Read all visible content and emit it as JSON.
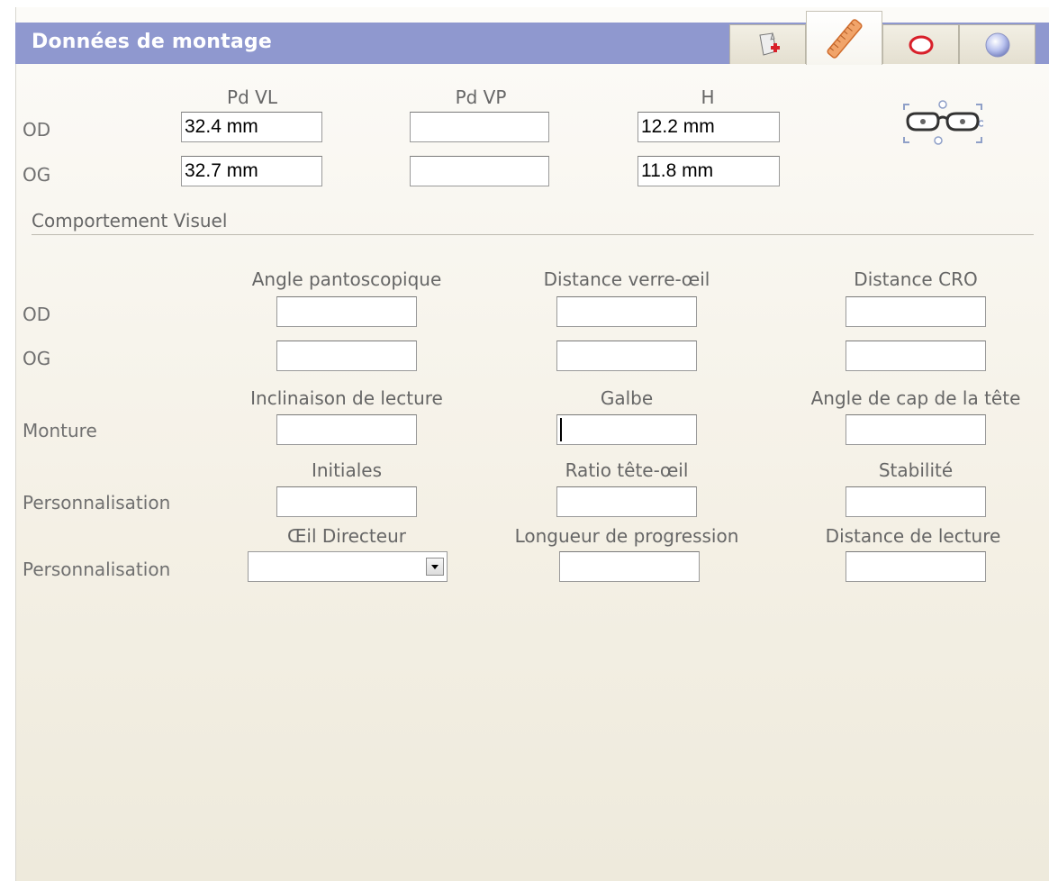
{
  "header": {
    "title": "Données de montage"
  },
  "tabs": [
    {
      "icon": "document-plus-icon",
      "active": false
    },
    {
      "icon": "ruler-icon",
      "active": true
    },
    {
      "icon": "lens-shape-icon",
      "active": false
    },
    {
      "icon": "sphere-icon",
      "active": false
    }
  ],
  "measurements": {
    "columns": [
      "Pd VL",
      "Pd VP",
      "H"
    ],
    "rows": [
      {
        "label": "OD",
        "values": [
          "32.4 mm",
          "",
          "12.2 mm"
        ]
      },
      {
        "label": "OG",
        "values": [
          "32.7 mm",
          "",
          "11.8 mm"
        ]
      }
    ]
  },
  "visual_behavior": {
    "section_title": "Comportement Visuel",
    "columns": [
      "Angle pantoscopique",
      "Distance verre-œil",
      "Distance CRO"
    ],
    "rows": [
      {
        "label": "OD",
        "values": [
          "",
          "",
          ""
        ]
      },
      {
        "label": "OG",
        "values": [
          "",
          "",
          ""
        ]
      }
    ],
    "monture": {
      "label": "Monture",
      "columns": [
        "Inclinaison de lecture",
        "Galbe",
        "Angle de cap de la tête"
      ],
      "values": [
        "",
        "",
        ""
      ]
    },
    "personnalisation1": {
      "label": "Personnalisation",
      "columns": [
        "Initiales",
        "Ratio tête-œil",
        "Stabilité"
      ],
      "values": [
        "",
        "",
        ""
      ]
    },
    "personnalisation2": {
      "label": "Personnalisation",
      "columns": [
        "Œil Directeur",
        "Longueur de progression",
        "Distance de lecture"
      ],
      "dominant_eye_selected": "",
      "values": [
        "",
        ""
      ]
    }
  },
  "colors": {
    "header_bg": "#8f98cf",
    "label_text": "#666666"
  }
}
